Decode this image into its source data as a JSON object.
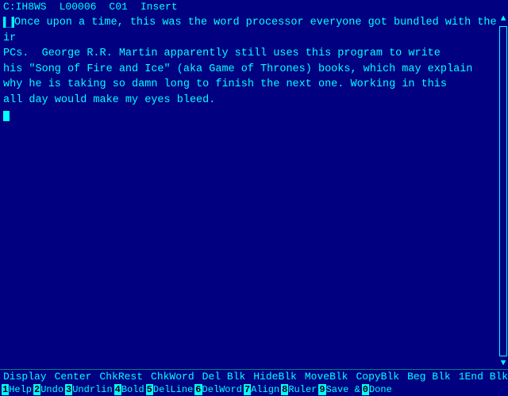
{
  "titlebar": {
    "file": "C:IH8WS",
    "position": "L00006",
    "col": "C01",
    "mode": "Insert"
  },
  "editor": {
    "lines": [
      "Once upon a time, this was the word processor everyone got bundled with their",
      "PCs.  George R.R. Martin apparently still uses this program to write",
      "his \"Song of Fire and Ice\" (aka Game of Thrones) books, which may explain",
      "why he is taking so damn long to finish the next one. Working in this",
      "all day would make my eyes bleed."
    ]
  },
  "statusbar": {
    "items": [
      "Display",
      "Center",
      "ChkRest",
      "ChkWord",
      "Del Blk",
      "HideBlk",
      "MoveBlk",
      "CopyBlk",
      "Beg Blk",
      "1End Blk"
    ]
  },
  "functionbar": {
    "keys": [
      {
        "num": "1",
        "label": "Help"
      },
      {
        "num": "2",
        "label": "Undo"
      },
      {
        "num": "3",
        "label": "Undrlin"
      },
      {
        "num": "4",
        "label": "Bold"
      },
      {
        "num": "5",
        "label": "DelLine"
      },
      {
        "num": "6",
        "label": "DelWord"
      },
      {
        "num": "7",
        "label": "Align"
      },
      {
        "num": "8",
        "label": "Ruler"
      },
      {
        "num": "9",
        "label": "Save &"
      },
      {
        "num": "0",
        "label": "Done"
      }
    ]
  },
  "colors": {
    "bg": "#000080",
    "fg": "#00ffff",
    "accent": "#00ffff"
  }
}
